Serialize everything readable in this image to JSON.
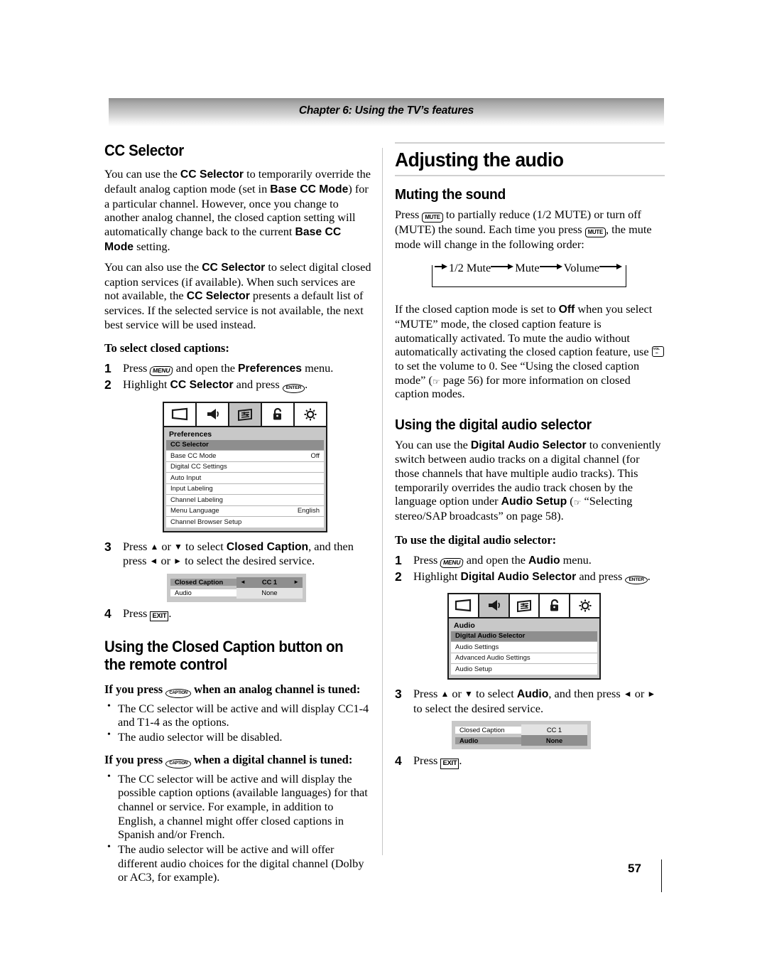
{
  "header": {
    "chapter_title": "Chapter 6: Using the TV’s features"
  },
  "left_column": {
    "heading": "CC Selector",
    "para1_a": "You can use the ",
    "para1_b": "CC Selector",
    "para1_c": " to temporarily override the default analog caption mode (set in ",
    "para1_d": "Base CC Mode",
    "para1_e": ") for a particular channel. However, once you change to another analog channel, the closed caption setting will automatically change back to the current ",
    "para1_f": "Base CC Mode",
    "para1_g": " setting.",
    "para2_a": "You can also use the ",
    "para2_b": "CC Selector",
    "para2_c": " to select digital closed caption services (if available). When such services are not available, the ",
    "para2_d": "CC Selector",
    "para2_e": " presents a default list of services. If the selected service is not available, the next best service will be used instead.",
    "lead1": "To select closed captions:",
    "step1_num": "1",
    "step1_a": "Press ",
    "step1_key": "MENU",
    "step1_b": " and open the ",
    "step1_c": "Preferences",
    "step1_d": " menu.",
    "step2_num": "2",
    "step2_a": "Highlight ",
    "step2_b": "CC Selector",
    "step2_c": " and press ",
    "step2_key": "ENTER",
    "step2_d": ".",
    "step3_num": "3",
    "step3_a": "Press ",
    "step3_b": " or ",
    "step3_c": " to select ",
    "step3_d": "Closed Caption",
    "step3_e": ", and then press ",
    "step3_f": " or ",
    "step3_g": " to select the desired service.",
    "step4_num": "4",
    "step4_a": "Press ",
    "step4_key": "EXIT",
    "step4_b": ".",
    "heading2_line1": "Using the Closed Caption button on",
    "heading2_line2": "the remote control",
    "lead2_a": "If you press ",
    "lead2_key": "CAPTION",
    "lead2_b": " when an analog channel is tuned:",
    "bullets_analog": [
      "The CC selector will be active and will display CC1-4 and T1-4 as the options.",
      "The audio selector will be disabled."
    ],
    "lead3_a": "If you press ",
    "lead3_key": "CAPTION",
    "lead3_b": " when a digital channel is tuned:",
    "bullets_digital": [
      "The CC selector will be active and will display the possible caption options (available languages) for that channel or service. For example, in addition to English, a channel might offer closed captions in Spanish and/or French.",
      "The audio selector will be active and will offer different audio choices for the digital channel (Dolby or AC3, for example)."
    ],
    "preferences_menu": {
      "title": "Preferences",
      "icons": [
        "picture-screen-icon",
        "speaker-audio-icon",
        "preferences-sliders-icon",
        "lock-icon",
        "setup-sun-icon"
      ],
      "active_icon_index": 2,
      "rows": [
        {
          "label": "CC Selector",
          "value": "",
          "selected": true
        },
        {
          "label": "Base CC Mode",
          "value": "Off",
          "selected": false
        },
        {
          "label": "Digital CC Settings",
          "value": "",
          "selected": false
        },
        {
          "label": "Auto Input",
          "value": "",
          "selected": false
        },
        {
          "label": "Input Labeling",
          "value": "",
          "selected": false
        },
        {
          "label": "Channel Labeling",
          "value": "",
          "selected": false
        },
        {
          "label": "Menu Language",
          "value": "English",
          "selected": false
        },
        {
          "label": "Channel Browser Setup",
          "value": "",
          "selected": false
        }
      ]
    },
    "cc_panel": {
      "rows": [
        {
          "label": "Closed Caption",
          "value": "CC 1",
          "highlighted": true,
          "arrows": true
        },
        {
          "label": "Audio",
          "value": "None",
          "highlighted": false,
          "arrows": false
        }
      ]
    }
  },
  "right_column": {
    "big_heading": "Adjusting the audio",
    "sub1": "Muting the sound",
    "mute_para_a": "Press ",
    "mute_key1": "MUTE",
    "mute_para_b": " to partially reduce (1/2 MUTE) or turn off (MUTE) the sound. Each time you press ",
    "mute_key2": "MUTE",
    "mute_para_c": ", the mute mode will change in the following order:",
    "mute_flow": [
      "1/2 Mute",
      "Mute",
      "Volume"
    ],
    "mute_para2_a": "If the closed caption mode is set to ",
    "mute_para2_b": "Off",
    "mute_para2_c": " when you select “MUTE” mode, the closed caption feature is automatically activated. To mute the audio without automatically activating the closed caption feature, use ",
    "mute_key3": "VOL",
    "mute_para2_d": " to set the volume to 0. See “Using the closed caption mode” (",
    "mute_para2_e": " page 56) for more information on closed caption modes.",
    "sub2": "Using the digital audio selector",
    "das_para_a": "You can use the ",
    "das_para_b": "Digital Audio Selector",
    "das_para_c": " to conveniently switch between audio tracks on a digital channel (for those channels that have multiple audio tracks). This temporarily overrides the audio track chosen by the language option under ",
    "das_para_d": "Audio Setup",
    "das_para_e": " (",
    "das_para_f": " “Selecting stereo/SAP broadcasts” on page 58).",
    "lead1": "To use the digital audio selector:",
    "step1_num": "1",
    "step1_a": "Press ",
    "step1_key": "MENU",
    "step1_b": " and open the ",
    "step1_c": "Audio",
    "step1_d": " menu.",
    "step2_num": "2",
    "step2_a": "Highlight ",
    "step2_b": "Digital Audio Selector",
    "step2_c": " and press ",
    "step2_key": "ENTER",
    "step2_d": ".",
    "step3_num": "3",
    "step3_a": "Press ",
    "step3_b": " or ",
    "step3_c": " to select ",
    "step3_d": "Audio",
    "step3_e": ", and then press ",
    "step3_f": " or ",
    "step3_g": " to select the desired service.",
    "step4_num": "4",
    "step4_a": "Press ",
    "step4_key": "EXIT",
    "step4_b": ".",
    "audio_menu": {
      "title": "Audio",
      "icons": [
        "picture-screen-icon",
        "speaker-audio-icon",
        "preferences-sliders-icon",
        "lock-icon",
        "setup-sun-icon"
      ],
      "active_icon_index": 1,
      "rows": [
        {
          "label": "Digital Audio Selector",
          "value": "",
          "selected": true
        },
        {
          "label": "Audio Settings",
          "value": "",
          "selected": false
        },
        {
          "label": "Advanced Audio Settings",
          "value": "",
          "selected": false
        },
        {
          "label": "Audio Setup",
          "value": "",
          "selected": false
        }
      ]
    },
    "cc_panel": {
      "rows": [
        {
          "label": "Closed Caption",
          "value": "CC 1",
          "highlighted": false,
          "arrows": false
        },
        {
          "label": "Audio",
          "value": "None",
          "highlighted": true,
          "arrows": false
        }
      ]
    }
  },
  "footer": {
    "page_number": "57"
  }
}
